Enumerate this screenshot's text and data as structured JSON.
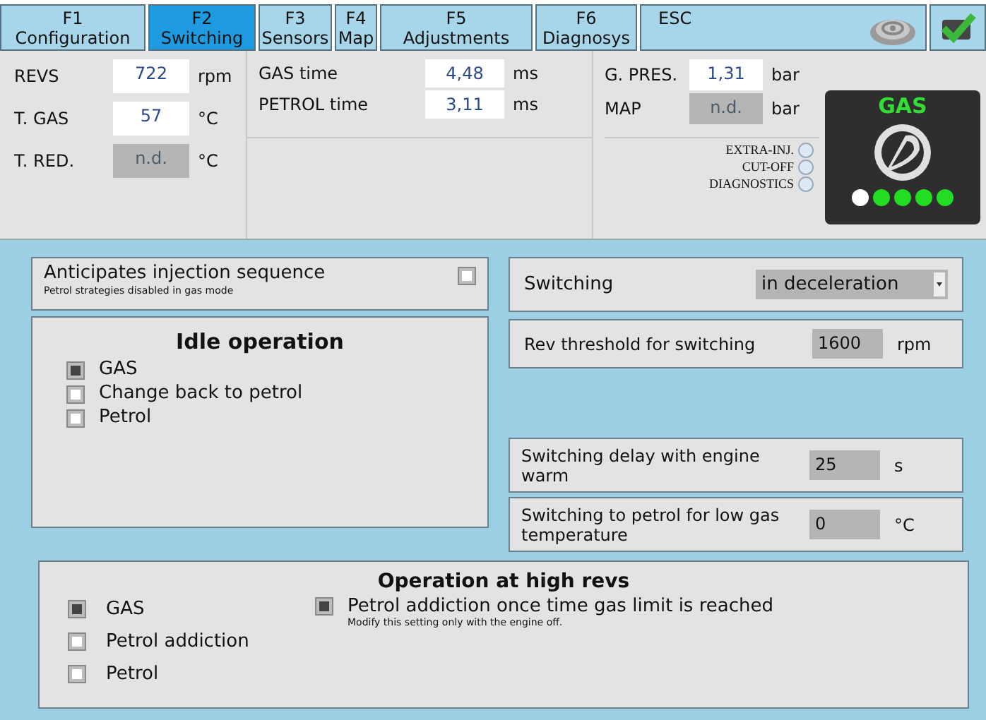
{
  "tabs": [
    {
      "key": "F1",
      "label": "Configuration",
      "selected": false
    },
    {
      "key": "F2",
      "label": "Switching",
      "selected": true
    },
    {
      "key": "F3",
      "label": "Sensors",
      "selected": false
    },
    {
      "key": "F4",
      "label": "Map",
      "selected": false
    },
    {
      "key": "F5",
      "label": "Adjustments",
      "selected": false
    },
    {
      "key": "F6",
      "label": "Diagnosys",
      "selected": false
    },
    {
      "key": "ESC",
      "selected": false
    }
  ],
  "status": {
    "left": [
      {
        "label": "REVS",
        "value": "722",
        "unit": "rpm",
        "disabled": false
      },
      {
        "label": "T. GAS",
        "value": "57",
        "unit": "°C",
        "disabled": false
      },
      {
        "label": "T. RED.",
        "value": "n.d.",
        "unit": "°C",
        "disabled": true
      }
    ],
    "middle": [
      {
        "label": "GAS time",
        "value": "4,48",
        "unit": "ms",
        "disabled": false
      },
      {
        "label": "PETROL time",
        "value": "3,11",
        "unit": "ms",
        "disabled": false
      }
    ],
    "right": [
      {
        "label": "G. PRES.",
        "value": "1,31",
        "unit": "bar",
        "disabled": false
      },
      {
        "label": "MAP",
        "value": "n.d.",
        "unit": "bar",
        "disabled": true
      }
    ],
    "indicators": [
      {
        "label": "EXTRA-INJ.",
        "on": false
      },
      {
        "label": "CUT-OFF",
        "on": false
      },
      {
        "label": "DIAGNOSTICS",
        "on": false
      }
    ],
    "fuel": {
      "label": "GAS",
      "dots": [
        {
          "color": "#ffffff"
        },
        {
          "color": "#22dd22"
        },
        {
          "color": "#22dd22"
        },
        {
          "color": "#22dd22"
        },
        {
          "color": "#22dd22"
        }
      ]
    }
  },
  "anticipates": {
    "label": "Anticipates injection sequence",
    "note": "Petrol strategies disabled in gas mode",
    "checked": false
  },
  "idle": {
    "title": "Idle operation",
    "options": [
      {
        "label": "GAS",
        "selected": true
      },
      {
        "label": "Change back to petrol",
        "selected": false
      },
      {
        "label": "Petrol",
        "selected": false
      }
    ]
  },
  "switching": {
    "label": "Switching",
    "value": "in deceleration"
  },
  "rev_threshold": {
    "label": "Rev threshold for switching",
    "value": "1600",
    "unit": "rpm"
  },
  "delay": {
    "label": "Switching delay with engine warm",
    "value": "25",
    "unit": "s"
  },
  "low_gas_temp": {
    "label": "Switching to petrol for low gas temperature",
    "value": "0",
    "unit": "°C"
  },
  "high_revs": {
    "title": "Operation at high revs",
    "options": [
      {
        "label": "GAS",
        "selected": true
      },
      {
        "label": "Petrol addiction",
        "selected": false
      },
      {
        "label": "Petrol",
        "selected": false
      }
    ],
    "addiction": {
      "label": "Petrol addiction once time gas limit is reached",
      "note": "Modify this setting only with the engine off.",
      "checked": true
    }
  }
}
